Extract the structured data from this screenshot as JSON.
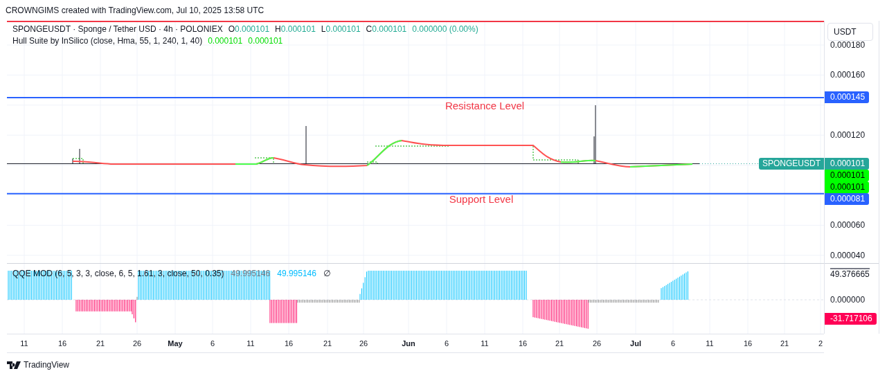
{
  "header": {
    "text": "CROWNGIMS created with TradingView.com, Jul 10, 2025 13:58 UTC"
  },
  "legend": {
    "symbol": "SPONGEUSDT · Sponge / Tether USD · 4h · POLONIEX",
    "ohlc": [
      {
        "label": "O",
        "value": "0.000101"
      },
      {
        "label": "H",
        "value": "0.000101"
      },
      {
        "label": "L",
        "value": "0.000101"
      },
      {
        "label": "C",
        "value": "0.000101"
      }
    ],
    "change": "0.000000 (0.00%)",
    "indicator": "Hull Suite by InSilico (close, Hma, 55, 1, 240, 1, 40)",
    "indicator_values": [
      "0.000101",
      "0.000101"
    ]
  },
  "annotations": [
    {
      "kind": "resistance",
      "text": "Resistance Level"
    },
    {
      "kind": "support",
      "text": "Support Level"
    }
  ],
  "price_axis": {
    "currency": "USDT",
    "ticks": [
      "0.000180",
      "0.000160",
      "0.000120",
      "0.000060",
      "0.000040"
    ],
    "badges": [
      {
        "kind": "resistance",
        "value": "0.000145"
      },
      {
        "kind": "last",
        "value": "0.000101",
        "tag": "SPONGEUSDT"
      },
      {
        "kind": "hull",
        "value": "0.000101"
      },
      {
        "kind": "hull",
        "value": "0.000101"
      },
      {
        "kind": "support",
        "value": "0.000081"
      }
    ]
  },
  "oscillator": {
    "title": "QQE MOD (6, 5, 3, 3, close, 6, 5, 1.61, 3, close, 50, 0.35)",
    "values": [
      {
        "kind": "neutral",
        "text": "49.995146"
      },
      {
        "kind": "signal",
        "text": "49.995146"
      },
      {
        "kind": "plain",
        "text": "∅"
      }
    ],
    "axis": [
      {
        "kind": "top",
        "text": "49.376665"
      },
      {
        "kind": "plain",
        "text": "0.000000"
      },
      {
        "kind": "negative",
        "text": "-31.717106"
      }
    ]
  },
  "time_axis": [
    {
      "label": "11",
      "kind": "day"
    },
    {
      "label": "16",
      "kind": "day"
    },
    {
      "label": "21",
      "kind": "day"
    },
    {
      "label": "26",
      "kind": "day"
    },
    {
      "label": "May",
      "kind": "month"
    },
    {
      "label": "6",
      "kind": "day"
    },
    {
      "label": "11",
      "kind": "day"
    },
    {
      "label": "16",
      "kind": "day"
    },
    {
      "label": "21",
      "kind": "day"
    },
    {
      "label": "26",
      "kind": "day"
    },
    {
      "label": "Jun",
      "kind": "month"
    },
    {
      "label": "6",
      "kind": "day"
    },
    {
      "label": "11",
      "kind": "day"
    },
    {
      "label": "16",
      "kind": "day"
    },
    {
      "label": "21",
      "kind": "day"
    },
    {
      "label": "26",
      "kind": "day"
    },
    {
      "label": "Jul",
      "kind": "month"
    },
    {
      "label": "6",
      "kind": "day"
    },
    {
      "label": "11",
      "kind": "day"
    },
    {
      "label": "16",
      "kind": "day"
    },
    {
      "label": "21",
      "kind": "day"
    },
    {
      "label": "2",
      "kind": "day"
    }
  ],
  "footer": {
    "brand": "TradingView"
  }
}
